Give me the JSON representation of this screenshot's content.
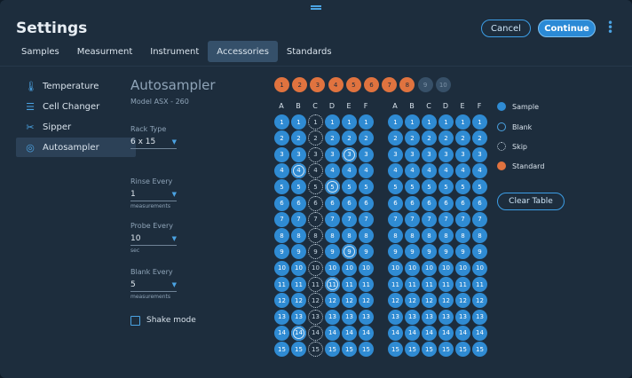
{
  "header": {
    "title": "Settings",
    "cancel_label": "Cancel",
    "continue_label": "Continue"
  },
  "tabs": [
    {
      "label": "Samples",
      "active": false
    },
    {
      "label": "Measurment",
      "active": false
    },
    {
      "label": "Instrument",
      "active": false
    },
    {
      "label": "Accessories",
      "active": true
    },
    {
      "label": "Standards",
      "active": false
    }
  ],
  "sidebar": {
    "items": [
      {
        "label": "Temperature",
        "icon": "thermometer-icon",
        "active": false
      },
      {
        "label": "Cell Changer",
        "icon": "cell-changer-icon",
        "active": false
      },
      {
        "label": "Sipper",
        "icon": "sipper-icon",
        "active": false
      },
      {
        "label": "Autosampler",
        "icon": "autosampler-icon",
        "active": true
      }
    ]
  },
  "panel": {
    "title": "Autosampler",
    "model": "Model ASX - 260",
    "rack_type": {
      "label": "Rack Type",
      "value": "6 x 15"
    },
    "rinse_every": {
      "label": "Rinse Every",
      "value": "1",
      "unit": "measurements"
    },
    "probe_every": {
      "label": "Probe Every",
      "value": "10",
      "unit": "sec"
    },
    "blank_every": {
      "label": "Blank Every",
      "value": "5",
      "unit": "measurements"
    },
    "shake_mode": {
      "label": "Shake mode",
      "checked": false
    }
  },
  "standards": {
    "labels": [
      "1",
      "2",
      "3",
      "4",
      "5",
      "6",
      "7",
      "8",
      "9",
      "10"
    ],
    "active_count": 8
  },
  "racks": {
    "columns": [
      "A",
      "B",
      "C",
      "D",
      "E",
      "F"
    ],
    "rows": [
      "1",
      "2",
      "3",
      "4",
      "5",
      "6",
      "7",
      "8",
      "9",
      "10",
      "11",
      "12",
      "13",
      "14",
      "15"
    ],
    "left_blanks": [
      "3-E",
      "4-B",
      "5-D",
      "9-E",
      "11-D",
      "14-B"
    ]
  },
  "legend": {
    "sample": "Sample",
    "blank": "Blank",
    "skip": "Skip",
    "standard": "Standard"
  },
  "clear_table_label": "Clear Table",
  "colors": {
    "background": "#1d2d3d",
    "accent": "#2f8bd3",
    "standard": "#e0733f"
  }
}
